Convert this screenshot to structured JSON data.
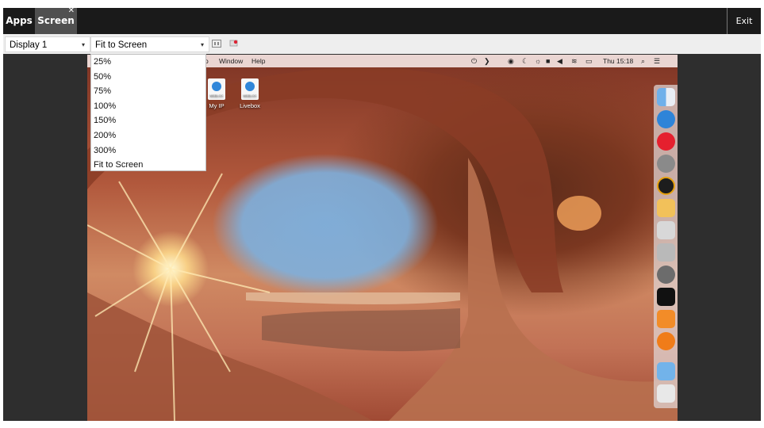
{
  "topbar": {
    "tabs": [
      {
        "label": "Apps"
      },
      {
        "label": "Screen"
      }
    ],
    "close_glyph": "✕",
    "exit_label": "Exit"
  },
  "toolbar": {
    "display_select": {
      "value": "Display 1"
    },
    "zoom_select": {
      "value": "Fit to Screen"
    },
    "caret_glyph": "▾",
    "icons": [
      "fit-window-icon",
      "screenshot-icon"
    ]
  },
  "zoom_dropdown": {
    "options": [
      "25%",
      "50%",
      "75%",
      "100%",
      "150%",
      "200%",
      "300%",
      "Fit to Screen"
    ]
  },
  "remote_desktop": {
    "menubar": {
      "items": [
        "o",
        "Window",
        "Help"
      ],
      "clock": "Thu 15:18"
    },
    "desktop_icons": [
      {
        "label": "My IP",
        "badge": "WEBLOC"
      },
      {
        "label": "Livebox",
        "badge": "WEBLOC"
      }
    ],
    "dock_items": [
      "finder-icon",
      "safari-icon",
      "opera-icon",
      "moon-icon",
      "plex-icon",
      "folder-icon",
      "utility-icon",
      "automator-icon",
      "system-preferences-icon",
      "terminal-icon",
      "sublime-icon",
      "ibooks-icon",
      "downloads-folder-icon",
      "trash-icon"
    ]
  },
  "colors": {
    "topbar": "#1a1a1a",
    "active_tab": "#505050",
    "toolbar": "#eeeeee",
    "stage": "#2e2e2e"
  }
}
